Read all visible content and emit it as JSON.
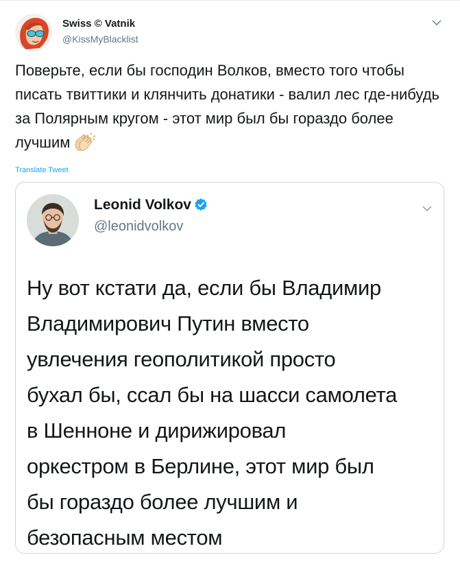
{
  "tweet": {
    "author_name": "Swiss © Vatnik",
    "author_handle": "@KissMyBlacklist",
    "text": "Поверьте, если бы господин Волков, вместо того чтобы писать твиттики и клянчить донатики - валил лес где-нибудь за Полярным кругом - этот мир был бы гораздо более лучшим",
    "emoji": "clapping-hands",
    "translate_label": "Translate Tweet"
  },
  "quoted_tweet": {
    "author_name": "Leonid Volkov",
    "author_handle": "@leonidvolkov",
    "verified": true,
    "lines": [
      "Ну вот кстати да, если бы Владимир",
      "Владимирович Путин вместо",
      "увлечения геополитикой просто",
      "бухал бы, ссал бы на шасси самолета",
      "в Шенноне и дирижировал",
      "оркестром в Берлине, этот мир был",
      "бы гораздо более лучшим и",
      "безопасным местом"
    ]
  },
  "colors": {
    "text": "#14171a",
    "secondary": "#657786",
    "link": "#1da1f2",
    "border": "#ccd6dd",
    "verified": "#1da1f2"
  }
}
